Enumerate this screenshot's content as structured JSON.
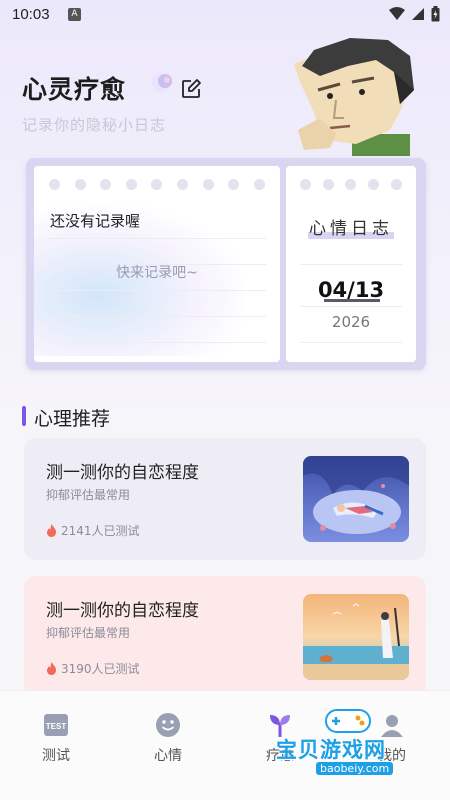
{
  "status_bar": {
    "time": "10:03",
    "notif_letter": "A"
  },
  "header": {
    "title": "心灵疗愈",
    "subtitle": "记录你的隐秘小日志"
  },
  "diary": {
    "empty_title": "还没有记录喔",
    "empty_hint": "快来记录吧~",
    "mood_title": "心情日志",
    "date": "04/13",
    "year": "2026"
  },
  "section": {
    "title": "心理推荐"
  },
  "recommendations": [
    {
      "title": "测一测你的自恋程度",
      "subtitle": "抑郁评估最常用",
      "count": "2141人已测试"
    },
    {
      "title": "测一测你的自恋程度",
      "subtitle": "抑郁评估最常用",
      "count": "3190人已测试"
    }
  ],
  "nav": [
    {
      "label": "测试",
      "icon": "test-icon"
    },
    {
      "label": "心情",
      "icon": "smile-icon"
    },
    {
      "label": "疗愈",
      "icon": "sprout-icon"
    },
    {
      "label": "我的",
      "icon": "profile-icon"
    }
  ],
  "watermark": {
    "text": "宝贝游戏网",
    "url": "baobeiy.com"
  },
  "colors": {
    "accent": "#7a58e0",
    "card1": "#eeedf6",
    "card2": "#fde9ea",
    "diary_frame": "#d8d6f1"
  }
}
